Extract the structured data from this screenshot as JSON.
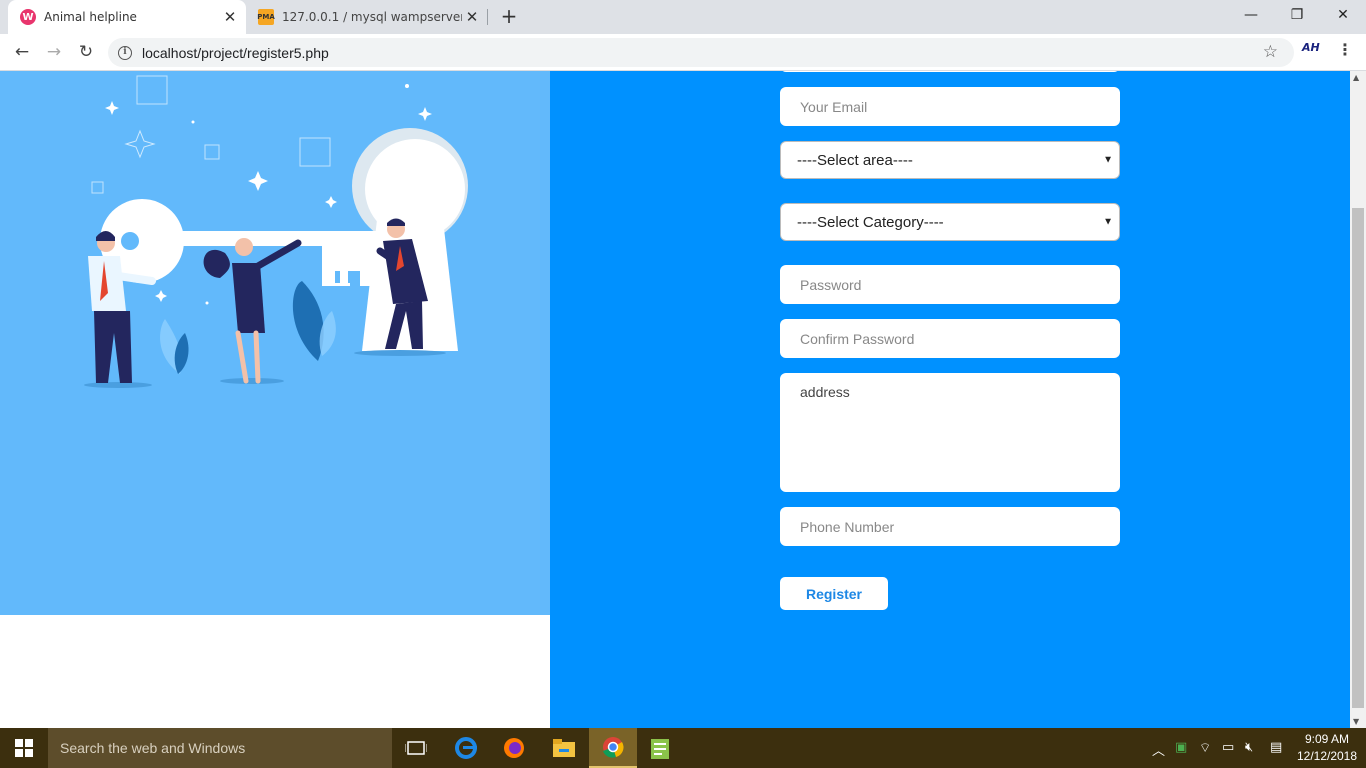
{
  "browser": {
    "tabs": [
      {
        "title": "Animal helpline",
        "favicon": "W"
      },
      {
        "title": "127.0.0.1 / mysql wampserver / a",
        "favicon": "PMA"
      }
    ],
    "new_tab_label": "+",
    "url": "localhost/project/register5.php",
    "window_controls": {
      "minimize": "—",
      "restore": "❐",
      "close": "✕"
    },
    "extension_label": "AH"
  },
  "form": {
    "email_placeholder": "Your Email",
    "area_select": "----Select area----",
    "category_select": "----Select Category----",
    "password_placeholder": "Password",
    "confirm_password_placeholder": "Confirm Password",
    "address_placeholder": "address",
    "phone_placeholder": "Phone Number",
    "register_label": "Register"
  },
  "colors": {
    "left_panel": "#62b9fb",
    "right_panel": "#0091ff",
    "button_text": "#1e88e5"
  },
  "taskbar": {
    "search_placeholder": "Search the web and Windows",
    "time": "9:09 AM",
    "date": "12/12/2018"
  }
}
